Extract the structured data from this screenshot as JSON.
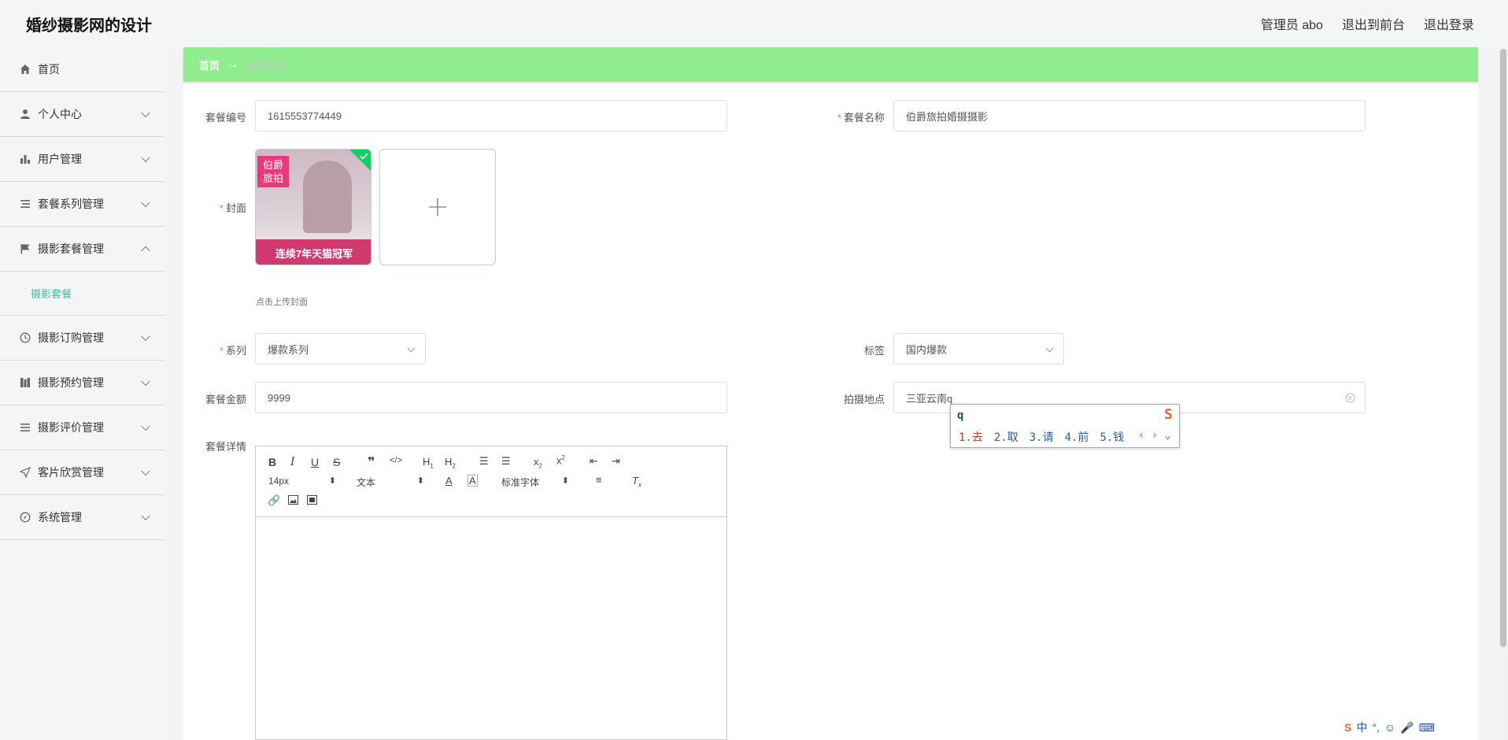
{
  "header": {
    "title": "婚纱摄影网的设计",
    "user": "管理员 abo",
    "front_link": "退出到前台",
    "logout": "退出登录"
  },
  "sidebar": {
    "items": [
      {
        "label": "首页",
        "icon": "home-icon"
      },
      {
        "label": "个人中心",
        "icon": "user-icon"
      },
      {
        "label": "用户管理",
        "icon": "bar-chart-icon"
      },
      {
        "label": "套餐系列管理",
        "icon": "list-icon"
      },
      {
        "label": "摄影套餐管理",
        "icon": "flag-icon",
        "expanded": true
      },
      {
        "label": "摄影订购管理",
        "icon": "clock-icon"
      },
      {
        "label": "摄影预约管理",
        "icon": "columns-icon"
      },
      {
        "label": "摄影评价管理",
        "icon": "menu-icon"
      },
      {
        "label": "客片欣赏管理",
        "icon": "send-icon"
      },
      {
        "label": "系统管理",
        "icon": "compass-icon"
      }
    ],
    "sub_active": "摄影套餐"
  },
  "breadcrumb": {
    "home": "首页",
    "arrow": "→",
    "current": "摄影套餐"
  },
  "form": {
    "package_no": {
      "label": "套餐编号",
      "value": "1615553774449"
    },
    "package_name": {
      "label": "套餐名称",
      "value": "伯爵旅拍婚摄摄影"
    },
    "cover": {
      "label": "封面",
      "hint": "点击上传封面",
      "image_text_top": "伯爵\n旅拍",
      "image_text_bottom": "连续7年天猫冠军"
    },
    "series": {
      "label": "系列",
      "value": "爆款系列"
    },
    "tag": {
      "label": "标签",
      "value": "国内爆款"
    },
    "price": {
      "label": "套餐金额",
      "value": "9999"
    },
    "location": {
      "label": "拍摄地点",
      "value": "三亚云南q"
    },
    "details": {
      "label": "套餐详情"
    }
  },
  "editor": {
    "font_size": "14px",
    "text_type": "文本",
    "font_family": "标准字体"
  },
  "ime": {
    "input": "q",
    "candidates": [
      "1.去",
      "2.取",
      "3.请",
      "4.前",
      "5.钱"
    ]
  },
  "colors": {
    "breadcrumb_bg": "#90ee90",
    "active_submenu": "#3fb9a0",
    "required": "#f56c6c"
  }
}
